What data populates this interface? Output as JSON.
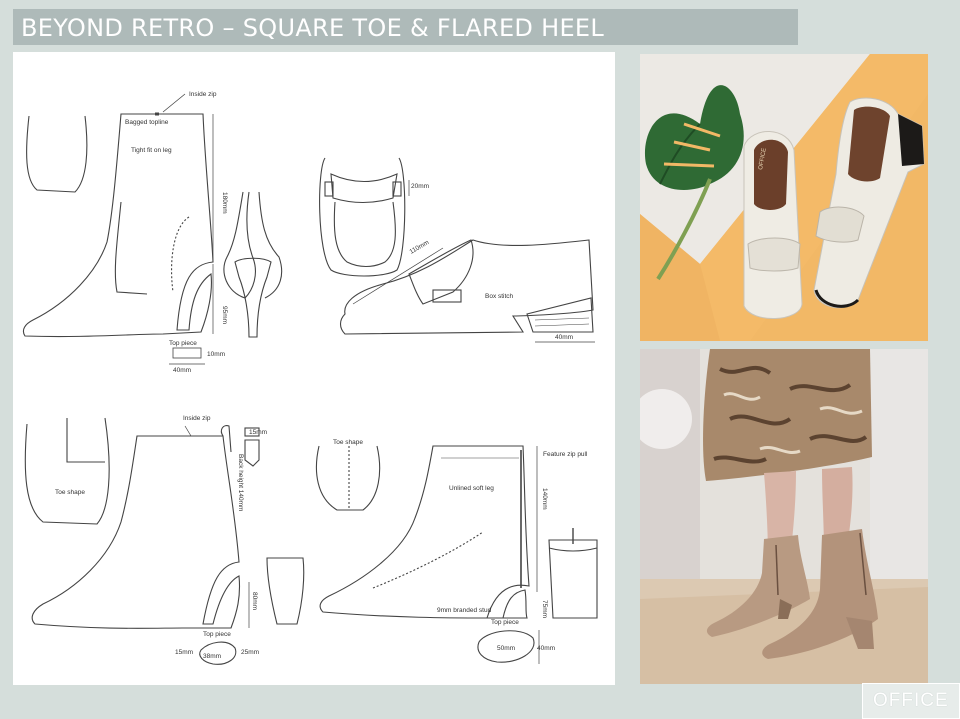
{
  "title": "BEYOND RETRO – SQUARE TOE & FLARED HEEL",
  "brand": "OFFICE",
  "annotations": {
    "inside_zip_1": "Inside zip",
    "bagged_topline": "Bagged topline",
    "tight_fit": "Tight fit on leg",
    "h180": "180mm",
    "h95": "95mm",
    "top_piece_1": "Top piece",
    "w10": "10mm",
    "w40": "40mm",
    "w20": "20mm",
    "w110": "110mm",
    "box_stitch": "Box stitch",
    "w40b": "40mm",
    "inside_zip_2": "Inside zip",
    "w15": "15mm",
    "back_height": "Back height 140mm",
    "toe_shape_1": "Toe shape",
    "h80": "80mm",
    "top_piece_2": "Top piece",
    "w15b": "15mm",
    "w38": "38mm",
    "w25": "25mm",
    "toe_shape_2": "Toe shape",
    "feature_zip": "Feature zip pull",
    "unlined": "Unlined soft leg",
    "h140": "140mm",
    "stud": "9mm branded stud",
    "h75": "75mm",
    "top_piece_3": "Top piece",
    "w50": "50mm",
    "h40": "40mm"
  },
  "photos": {
    "top_brand_insole": "OFFICE"
  },
  "colors": {
    "background": "#d5dedb",
    "title_bar": "#aebab9",
    "sheet": "#ffffff",
    "photo_top_bg": "#f2b866",
    "photo_bottom_bg": "#e4e1dc"
  }
}
